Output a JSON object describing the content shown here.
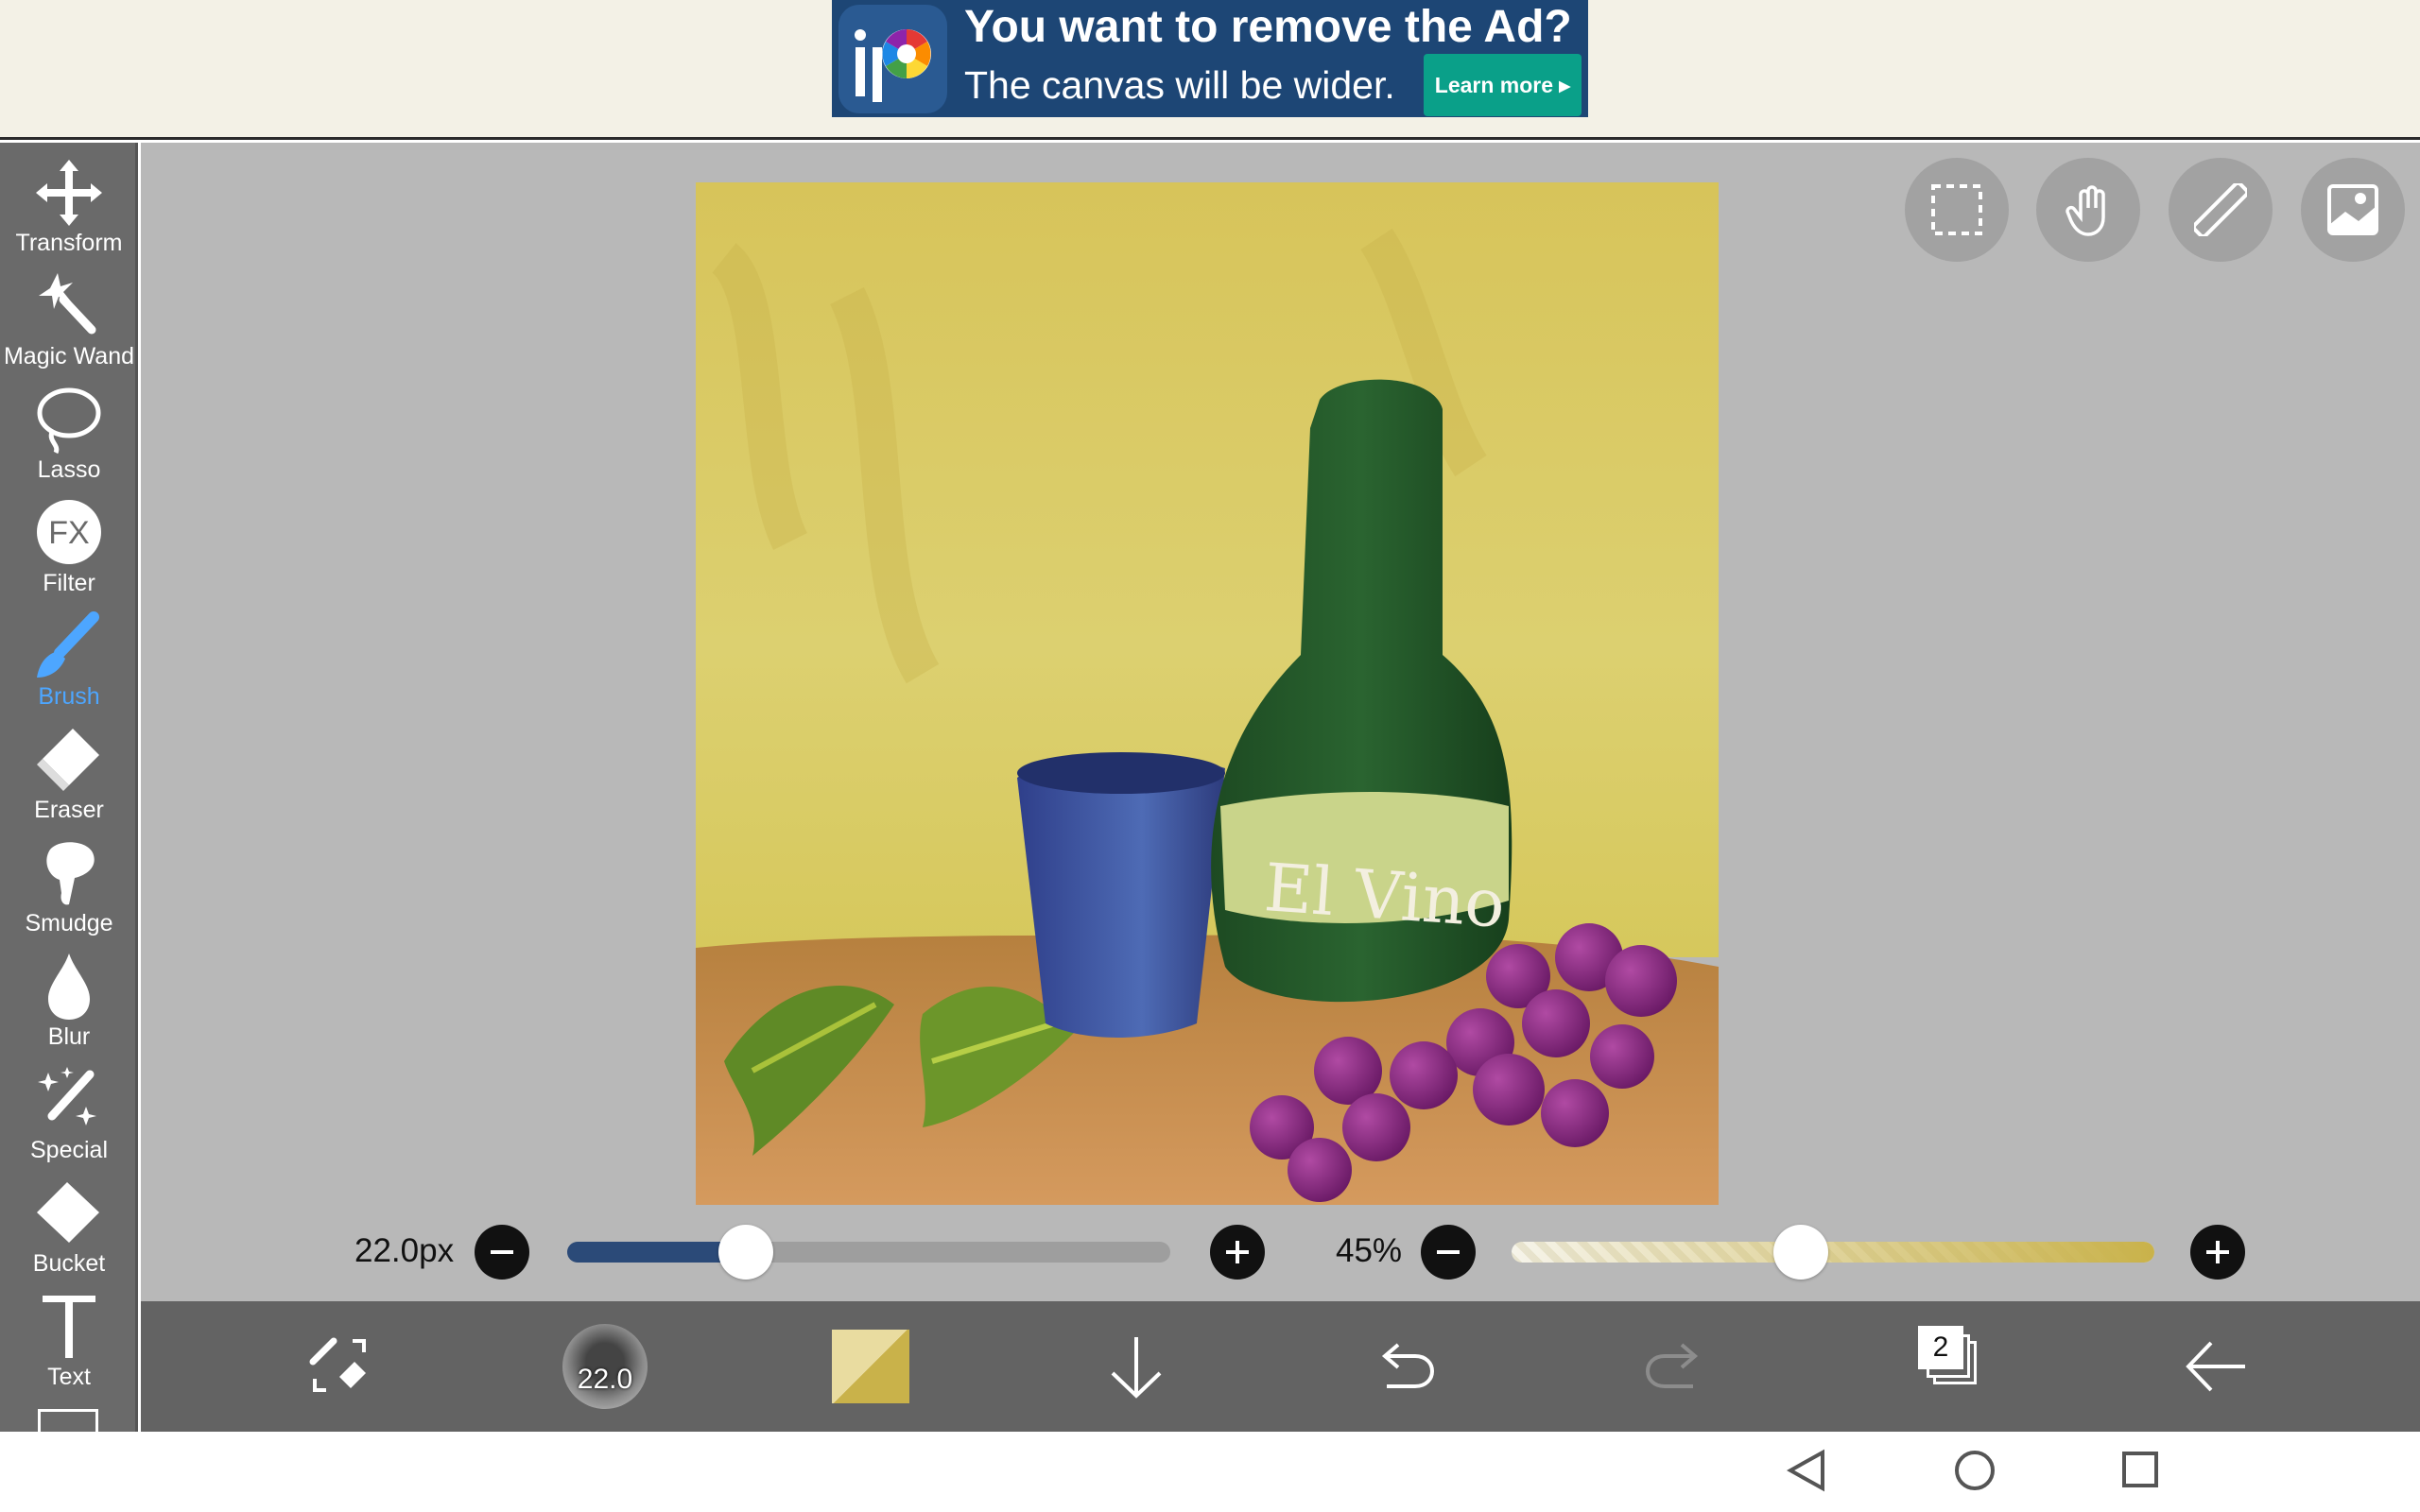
{
  "ad": {
    "title": "You want to remove the Ad?",
    "subtitle": "The canvas will be wider.",
    "cta": "Learn more ▸"
  },
  "tools": [
    {
      "label": "Transform",
      "icon": "move-arrows-icon"
    },
    {
      "label": "Magic Wand",
      "icon": "magic-wand-icon"
    },
    {
      "label": "Lasso",
      "icon": "lasso-icon"
    },
    {
      "label": "Filter",
      "icon": "fx-icon"
    },
    {
      "label": "Brush",
      "icon": "brush-icon",
      "active": true
    },
    {
      "label": "Eraser",
      "icon": "eraser-icon"
    },
    {
      "label": "Smudge",
      "icon": "smudge-icon"
    },
    {
      "label": "Blur",
      "icon": "droplet-icon"
    },
    {
      "label": "Special",
      "icon": "sparkle-pen-icon"
    },
    {
      "label": "Bucket",
      "icon": "bucket-icon"
    },
    {
      "label": "Text",
      "icon": "text-t-icon"
    }
  ],
  "canvas": {
    "bottle_label_text": "El Vino"
  },
  "brush_size": {
    "label": "22.0px",
    "value": 22.0,
    "fraction": 0.28
  },
  "opacity": {
    "label": "45%",
    "value": 45
  },
  "bottom": {
    "brush_preview_label": "22.0",
    "layer_count": "2"
  },
  "colors": {
    "accent": "#4da6ff",
    "canvas_bg": "#d9c65c",
    "slider_fill": "#2b4a78",
    "primary_color": "#c9b24a"
  }
}
